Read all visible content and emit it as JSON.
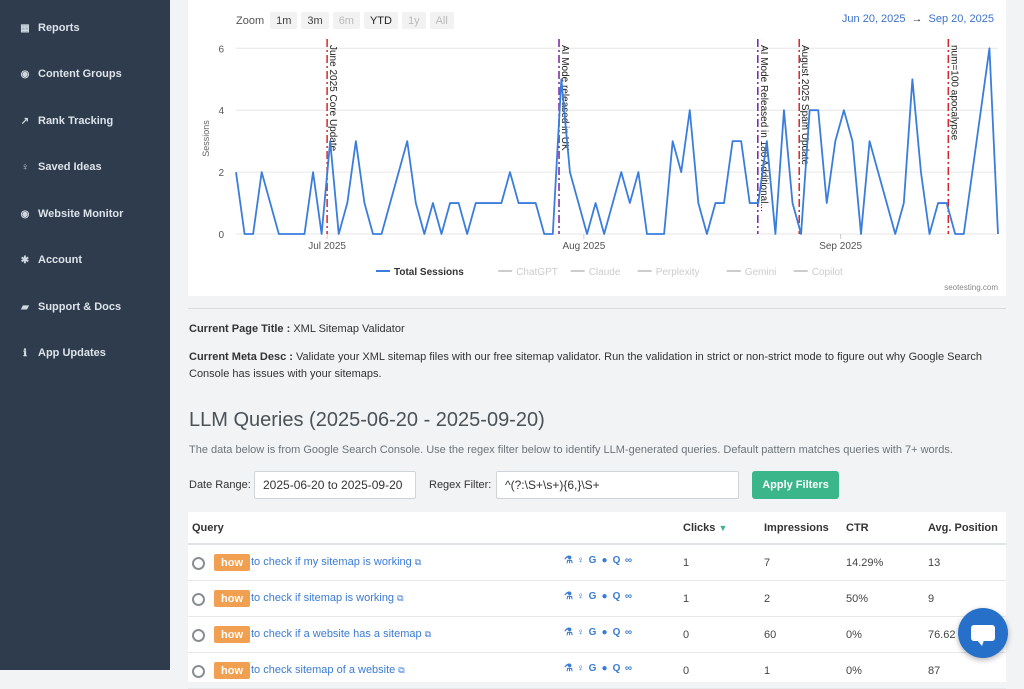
{
  "sidebar": {
    "items": [
      {
        "label": "Reports",
        "icon": "table-icon",
        "glyph": "▦"
      },
      {
        "label": "Content Groups",
        "icon": "gamepad-icon",
        "glyph": "◉"
      },
      {
        "label": "Rank Tracking",
        "icon": "line-chart-icon",
        "glyph": "↗"
      },
      {
        "label": "Saved Ideas",
        "icon": "lightbulb-icon",
        "glyph": "♀"
      },
      {
        "label": "Website Monitor",
        "icon": "eye-icon",
        "glyph": "◉"
      },
      {
        "label": "Account",
        "icon": "gear-icon",
        "glyph": "✱"
      },
      {
        "label": "Support & Docs",
        "icon": "book-icon",
        "glyph": "▰"
      },
      {
        "label": "App Updates",
        "icon": "info-icon",
        "glyph": "ℹ"
      }
    ]
  },
  "chart": {
    "zoom_label": "Zoom",
    "zoom_buttons": [
      {
        "label": "1m",
        "state": "enabled"
      },
      {
        "label": "3m",
        "state": "enabled"
      },
      {
        "label": "6m",
        "state": "disabled"
      },
      {
        "label": "YTD",
        "state": "active"
      },
      {
        "label": "1y",
        "state": "disabled"
      },
      {
        "label": "All",
        "state": "disabled"
      }
    ],
    "date_from": "Jun 20, 2025",
    "date_arrow": "→",
    "date_to": "Sep 20, 2025",
    "credit": "seotesting.com"
  },
  "chart_data": {
    "type": "line",
    "ylabel": "Sessions",
    "xlabel": "",
    "title": "",
    "ylim": [
      0,
      6.3
    ],
    "yticks": [
      "0",
      "2",
      "4",
      "6"
    ],
    "x_start": "2025-06-20",
    "x_end": "2025-09-20",
    "xticks": [
      {
        "label": "Jul 2025",
        "date": "2025-07-01"
      },
      {
        "label": "Aug 2025",
        "date": "2025-08-01"
      },
      {
        "label": "Sep 2025",
        "date": "2025-09-01"
      }
    ],
    "series": [
      {
        "name": "Total Sessions",
        "color": "#3b7ddd",
        "visible": true,
        "values": [
          2,
          0,
          0,
          2,
          1,
          0,
          0,
          0,
          0,
          2,
          0,
          3,
          0,
          1,
          3,
          1,
          0,
          0,
          1,
          2,
          3,
          1,
          0,
          1,
          0,
          1,
          1,
          0,
          1,
          1,
          1,
          1,
          2,
          1,
          1,
          1,
          0,
          0,
          5,
          2,
          1,
          0,
          1,
          0,
          1,
          2,
          1,
          2,
          0,
          0,
          0,
          3,
          2,
          4,
          1,
          0,
          1,
          1,
          3,
          3,
          1,
          1,
          3,
          0,
          4,
          1,
          0,
          4,
          4,
          1,
          3,
          4,
          3,
          0,
          3,
          2,
          1,
          0,
          1,
          5,
          2,
          0,
          1,
          1,
          0,
          0,
          2,
          4,
          6,
          0
        ]
      },
      {
        "name": "ChatGPT",
        "color": "#cccccc",
        "visible": false,
        "values": []
      },
      {
        "name": "Claude",
        "color": "#cccccc",
        "visible": false,
        "values": []
      },
      {
        "name": "Perplexity",
        "color": "#cccccc",
        "visible": false,
        "values": []
      },
      {
        "name": "Gemini",
        "color": "#cccccc",
        "visible": false,
        "values": []
      },
      {
        "name": "Copilot",
        "color": "#cccccc",
        "visible": false,
        "values": []
      }
    ],
    "annotations": [
      {
        "date": "2025-07-01",
        "label": "June 2025 Core Update",
        "color": "#d9262c"
      },
      {
        "date": "2025-07-29",
        "label": "AI Mode released in UK",
        "color": "#7b1fa2"
      },
      {
        "date": "2025-08-22",
        "label": "AI Mode Released in 180 Additional...",
        "color": "#7b1fa2"
      },
      {
        "date": "2025-08-27",
        "label": "August 2025 Spam Update",
        "color": "#d9262c"
      },
      {
        "date": "2025-09-14",
        "label": "num=100 apocalypse",
        "color": "#d9262c"
      }
    ],
    "legend_position": "bottom"
  },
  "page_info": {
    "title_label": "Current Page Title :",
    "title_value": "XML Sitemap Validator",
    "meta_label": "Current Meta Desc :",
    "meta_value": "Validate your XML sitemap files with our free sitemap validator. Run the validation in strict or non-strict mode to figure out why Google Search Console has issues with your sitemaps."
  },
  "llm": {
    "heading": "LLM Queries (2025-06-20 - 2025-09-20)",
    "description": "The data below is from Google Search Console. Use the regex filter below to identify LLM-generated queries. Default pattern matches queries with 7+ words.",
    "date_range_label": "Date Range:",
    "date_range_value": "2025-06-20 to 2025-09-20",
    "regex_label": "Regex Filter:",
    "regex_value": "^(?:\\S+\\s+){6,}\\S+",
    "apply_label": "Apply Filters"
  },
  "table": {
    "headers": {
      "query": "Query",
      "clicks": "Clicks",
      "impressions": "Impressions",
      "ctr": "CTR",
      "position": "Avg. Position"
    },
    "rows": [
      {
        "badge": "how",
        "query": "to check if my sitemap is working",
        "clicks": "1",
        "impressions": "7",
        "ctr": "14.29%",
        "position": "13"
      },
      {
        "badge": "how",
        "query": "to check if sitemap is working",
        "clicks": "1",
        "impressions": "2",
        "ctr": "50%",
        "position": "9"
      },
      {
        "badge": "how",
        "query": "to check if a website has a sitemap",
        "clicks": "0",
        "impressions": "60",
        "ctr": "0%",
        "position": "76.62"
      },
      {
        "badge": "how",
        "query": "to check sitemap of a website",
        "clicks": "0",
        "impressions": "1",
        "ctr": "0%",
        "position": "87"
      }
    ],
    "tool_icons": [
      "flask-icon",
      "lightbulb-icon",
      "google-icon",
      "chatgpt-icon",
      "search-icon",
      "link-icon"
    ]
  }
}
